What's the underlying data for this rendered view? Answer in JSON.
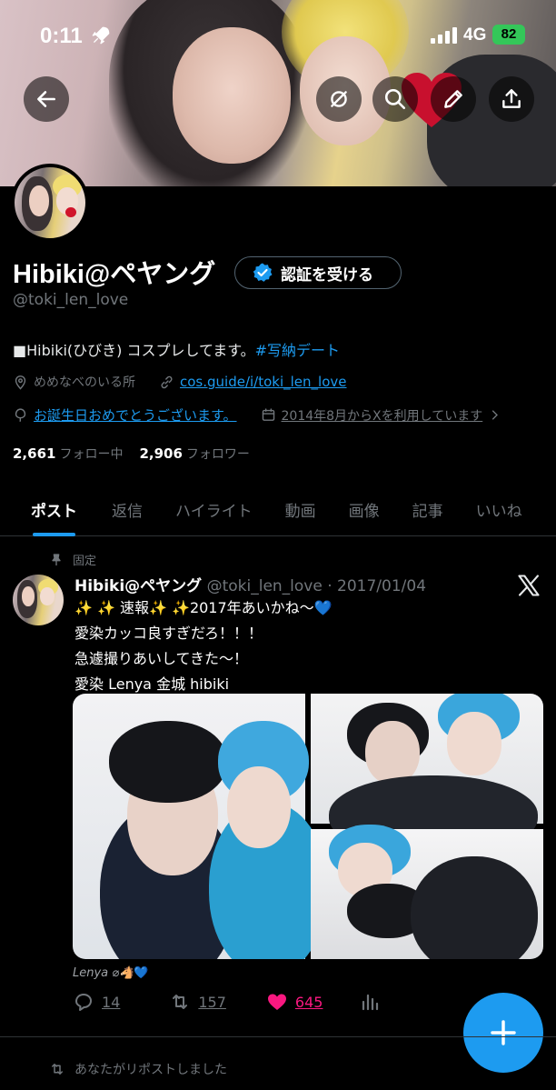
{
  "status_bar": {
    "time": "0:11",
    "network": "4G",
    "battery": "82"
  },
  "profile": {
    "display_name": "Hibiki@ペヤング",
    "verify_button": "認証を受ける",
    "handle": "@toki_len_love",
    "bio_text": "■Hibiki(ひびき) コスプレしてます。",
    "bio_hashtag": "#写納デート",
    "location": "めめなべのいる所",
    "website": "cos.guide/i/toki_len_love",
    "birthday": "お誕生日おめでとうございます。",
    "joined": "2014年8月からXを利用しています",
    "following_count": "2,661",
    "following_label": "フォロー中",
    "followers_count": "2,906",
    "followers_label": "フォロワー"
  },
  "tabs": [
    {
      "label": "ポスト",
      "active": true
    },
    {
      "label": "返信"
    },
    {
      "label": "ハイライト"
    },
    {
      "label": "動画"
    },
    {
      "label": "画像"
    },
    {
      "label": "記事"
    },
    {
      "label": "いいね"
    }
  ],
  "post": {
    "pinned_label": "固定",
    "author_name": "Hibiki@ペヤング",
    "author_handle": "@toki_len_love",
    "date": "2017/01/04",
    "lines": [
      "✨ ✨ 速報✨ ✨2017年あいかね〜💙",
      "愛染カッコ良すぎだろ！！！",
      "急遽撮りあいしてきた〜！",
      "愛染 Lenya 金城 hibiki"
    ],
    "image_caption": "Lenya ⌀🐴",
    "image_caption_heart": "💙",
    "replies": "14",
    "reposts": "157",
    "likes": "645"
  },
  "repost_note": "あなたがリポストしました",
  "colors": {
    "accent": "#1d9bf0",
    "like": "#f91880",
    "muted": "#71767b",
    "background": "#000000"
  },
  "icons": [
    "back-arrow-icon",
    "mute-icon",
    "search-icon",
    "edit-icon",
    "share-icon",
    "verified-icon",
    "location-icon",
    "link-icon",
    "birthday-icon",
    "calendar-icon",
    "pin-icon",
    "x-logo-icon",
    "reply-icon",
    "repost-icon",
    "like-icon",
    "analytics-icon",
    "compose-icon"
  ]
}
